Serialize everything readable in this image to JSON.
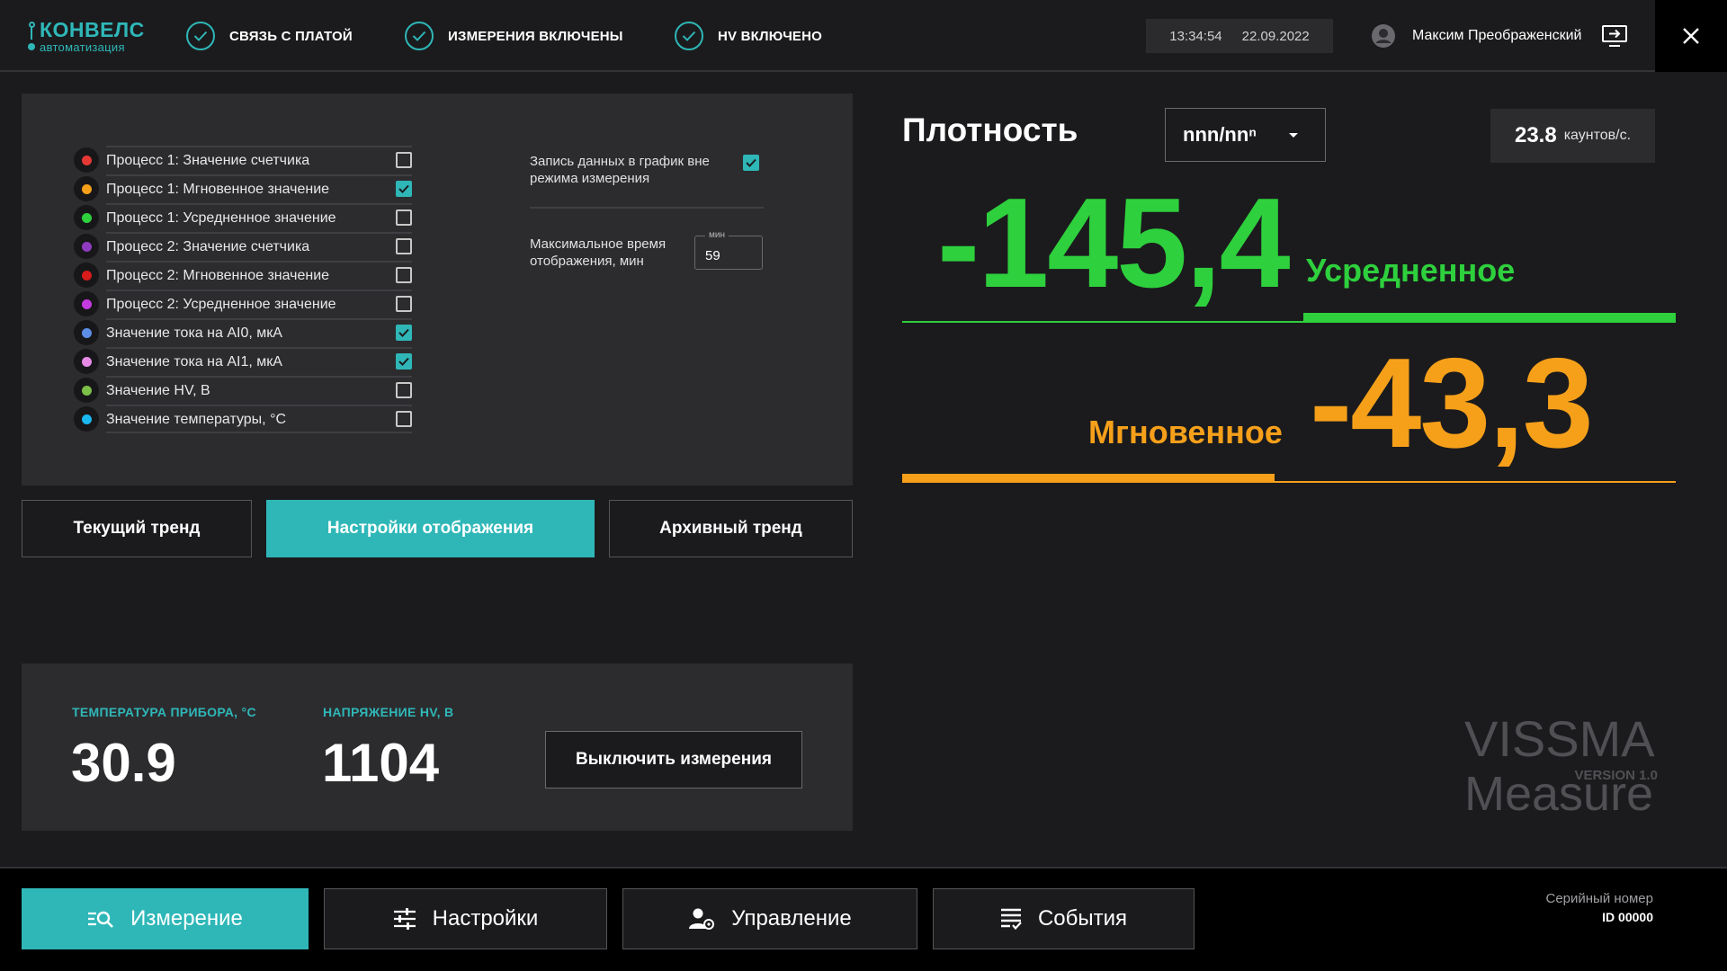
{
  "header": {
    "logo_main": "КОНВЕЛС",
    "logo_sub": "автоматизация",
    "status_items": [
      {
        "label": "СВЯЗЬ С ПЛАТОЙ",
        "icon": "check-circle-icon"
      },
      {
        "label": "ИЗМЕРЕНИЯ ВКЛЮЧЕНЫ",
        "icon": "check-circle-icon"
      },
      {
        "label": "HV ВКЛЮЧЕНО",
        "icon": "check-circle-icon"
      }
    ],
    "time": "13:34:54",
    "date": "22.09.2022",
    "user_name": "Максим Преображенский"
  },
  "channels": [
    {
      "label": "Процесс 1: Значение счетчика",
      "color": "#e53935",
      "checked": false
    },
    {
      "label": "Процесс 1: Мгновенное значение",
      "color": "#f6a01a",
      "checked": true
    },
    {
      "label": "Процесс 1: Усредненное значение",
      "color": "#2ed03d",
      "checked": false
    },
    {
      "label": "Процесс 2: Значение счетчика",
      "color": "#8e3bbf",
      "checked": false
    },
    {
      "label": "Процесс 2: Мгновенное значение",
      "color": "#d81b1b",
      "checked": false
    },
    {
      "label": "Процесс 2: Усредненное значение",
      "color": "#c43be0",
      "checked": false
    },
    {
      "label": "Значение тока на AI0, мкА",
      "color": "#5c8ee6",
      "checked": true
    },
    {
      "label": "Значение тока на AI1, мкА",
      "color": "#e68ae6",
      "checked": true
    },
    {
      "label": "Значение HV, В",
      "color": "#7cc04a",
      "checked": false
    },
    {
      "label": "Значение температуры, °С",
      "color": "#1ab8f0",
      "checked": false
    }
  ],
  "options": {
    "record_label": "Запись данных в график вне режима измерения",
    "record_checked": true,
    "max_time_label": "Максимальное время отображения, мин",
    "max_time_unit": "мин",
    "max_time_value": "59"
  },
  "tabs": [
    {
      "label": "Текущий тренд",
      "active": false
    },
    {
      "label": "Настройки отображения",
      "active": true
    },
    {
      "label": "Архивный тренд",
      "active": false
    }
  ],
  "info": {
    "temp_label": "ТЕМПЕРАТУРА ПРИБОРА, °С",
    "temp_value": "30.9",
    "hv_label": "НАПРЯЖЕНИЕ HV, В",
    "hv_value": "1104",
    "stop_label": "Выключить измерения"
  },
  "density": {
    "title": "Плотность",
    "unit": "nnn/nnⁿ",
    "counts_value": "23.8",
    "counts_unit": "каунтов/с.",
    "avg_value": "-145,4",
    "avg_label": "Усредненное",
    "inst_value": "-43,3",
    "inst_label": "Мгновенное"
  },
  "brand": {
    "name": "VISSMA",
    "version": "VERSION 1.0",
    "product": "Measure"
  },
  "nav": [
    {
      "label": "Измерение",
      "icon": "measure-search-icon",
      "active": true
    },
    {
      "label": "Настройки",
      "icon": "sliders-icon",
      "active": false
    },
    {
      "label": "Управление",
      "icon": "user-gear-icon",
      "active": false
    },
    {
      "label": "События",
      "icon": "event-list-icon",
      "active": false
    }
  ],
  "serial": {
    "label": "Серийный номер",
    "value": "ID 00000"
  },
  "colors": {
    "accent": "#2fb7b8",
    "average": "#2ed03d",
    "instant": "#f6a01a",
    "background": "#1b1b1d",
    "panel": "#2c2c2f"
  }
}
